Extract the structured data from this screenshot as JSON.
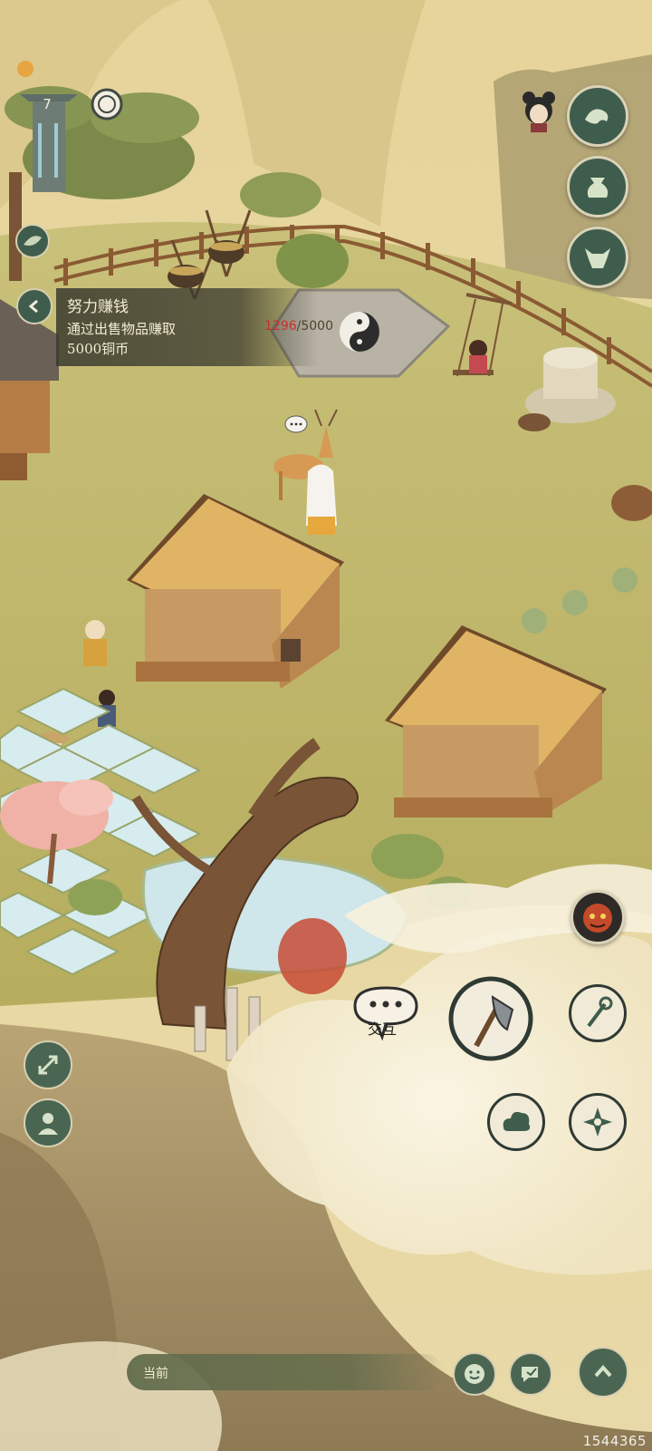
{
  "hud": {
    "level": "7",
    "quest": {
      "title": "努力赚钱",
      "description": "通过出售物品赚取",
      "reward": "5000铜币",
      "progress_current": "1296",
      "progress_total": "/5000"
    },
    "interact_label": "交互",
    "bottom_label": "当前",
    "watermark": "1544365"
  },
  "icons": {
    "level_tower": "stone-pillar-icon",
    "spiral": "spiral-icon",
    "leaf": "leaf-icon",
    "back": "chevron-left-icon",
    "avatar": "character-avatar",
    "wind": "wind-wave-icon",
    "bag": "pouch-icon",
    "ox": "ox-head-icon",
    "monster": "monster-face-icon",
    "axe": "axe-icon",
    "staff": "staff-icon",
    "cloud": "cloud-swirl-icon",
    "shuriken": "diamond-star-icon",
    "expand": "expand-icon",
    "person": "person-icon",
    "emote": "smile-icon",
    "chat": "chat-edit-icon",
    "up": "chevron-up-icon"
  },
  "colors": {
    "button_dark": "#3f5d4d",
    "button_light": "#f1ead6",
    "accent_red": "#c7312c",
    "grass": "#bfbf6d",
    "sky": "#e8d9a4"
  }
}
